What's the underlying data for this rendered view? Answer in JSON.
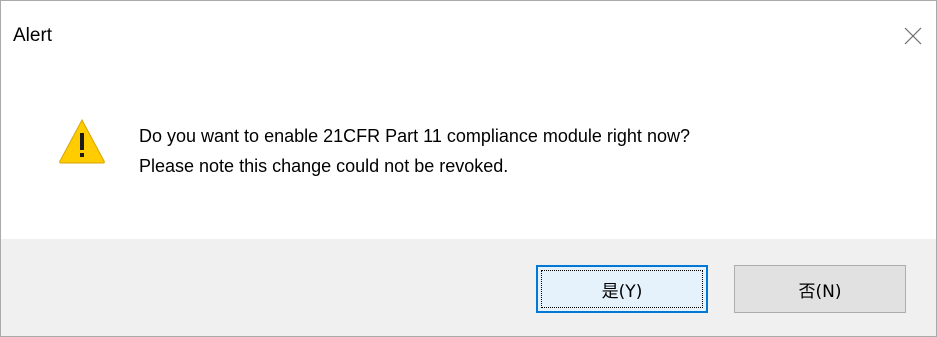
{
  "dialog": {
    "title": "Alert",
    "close_icon": "close-icon",
    "warning_icon": "warning-icon",
    "message_line1": "Do you want to enable 21CFR Part 11 compliance module right now?",
    "message_line2": "Please note this change could not be revoked.",
    "yes_label": "是(Y)",
    "no_label": "否(N)"
  },
  "colors": {
    "footer_bg": "#f0f0f0",
    "focus_border": "#0078d7",
    "warning_fill": "#ffcc00"
  }
}
